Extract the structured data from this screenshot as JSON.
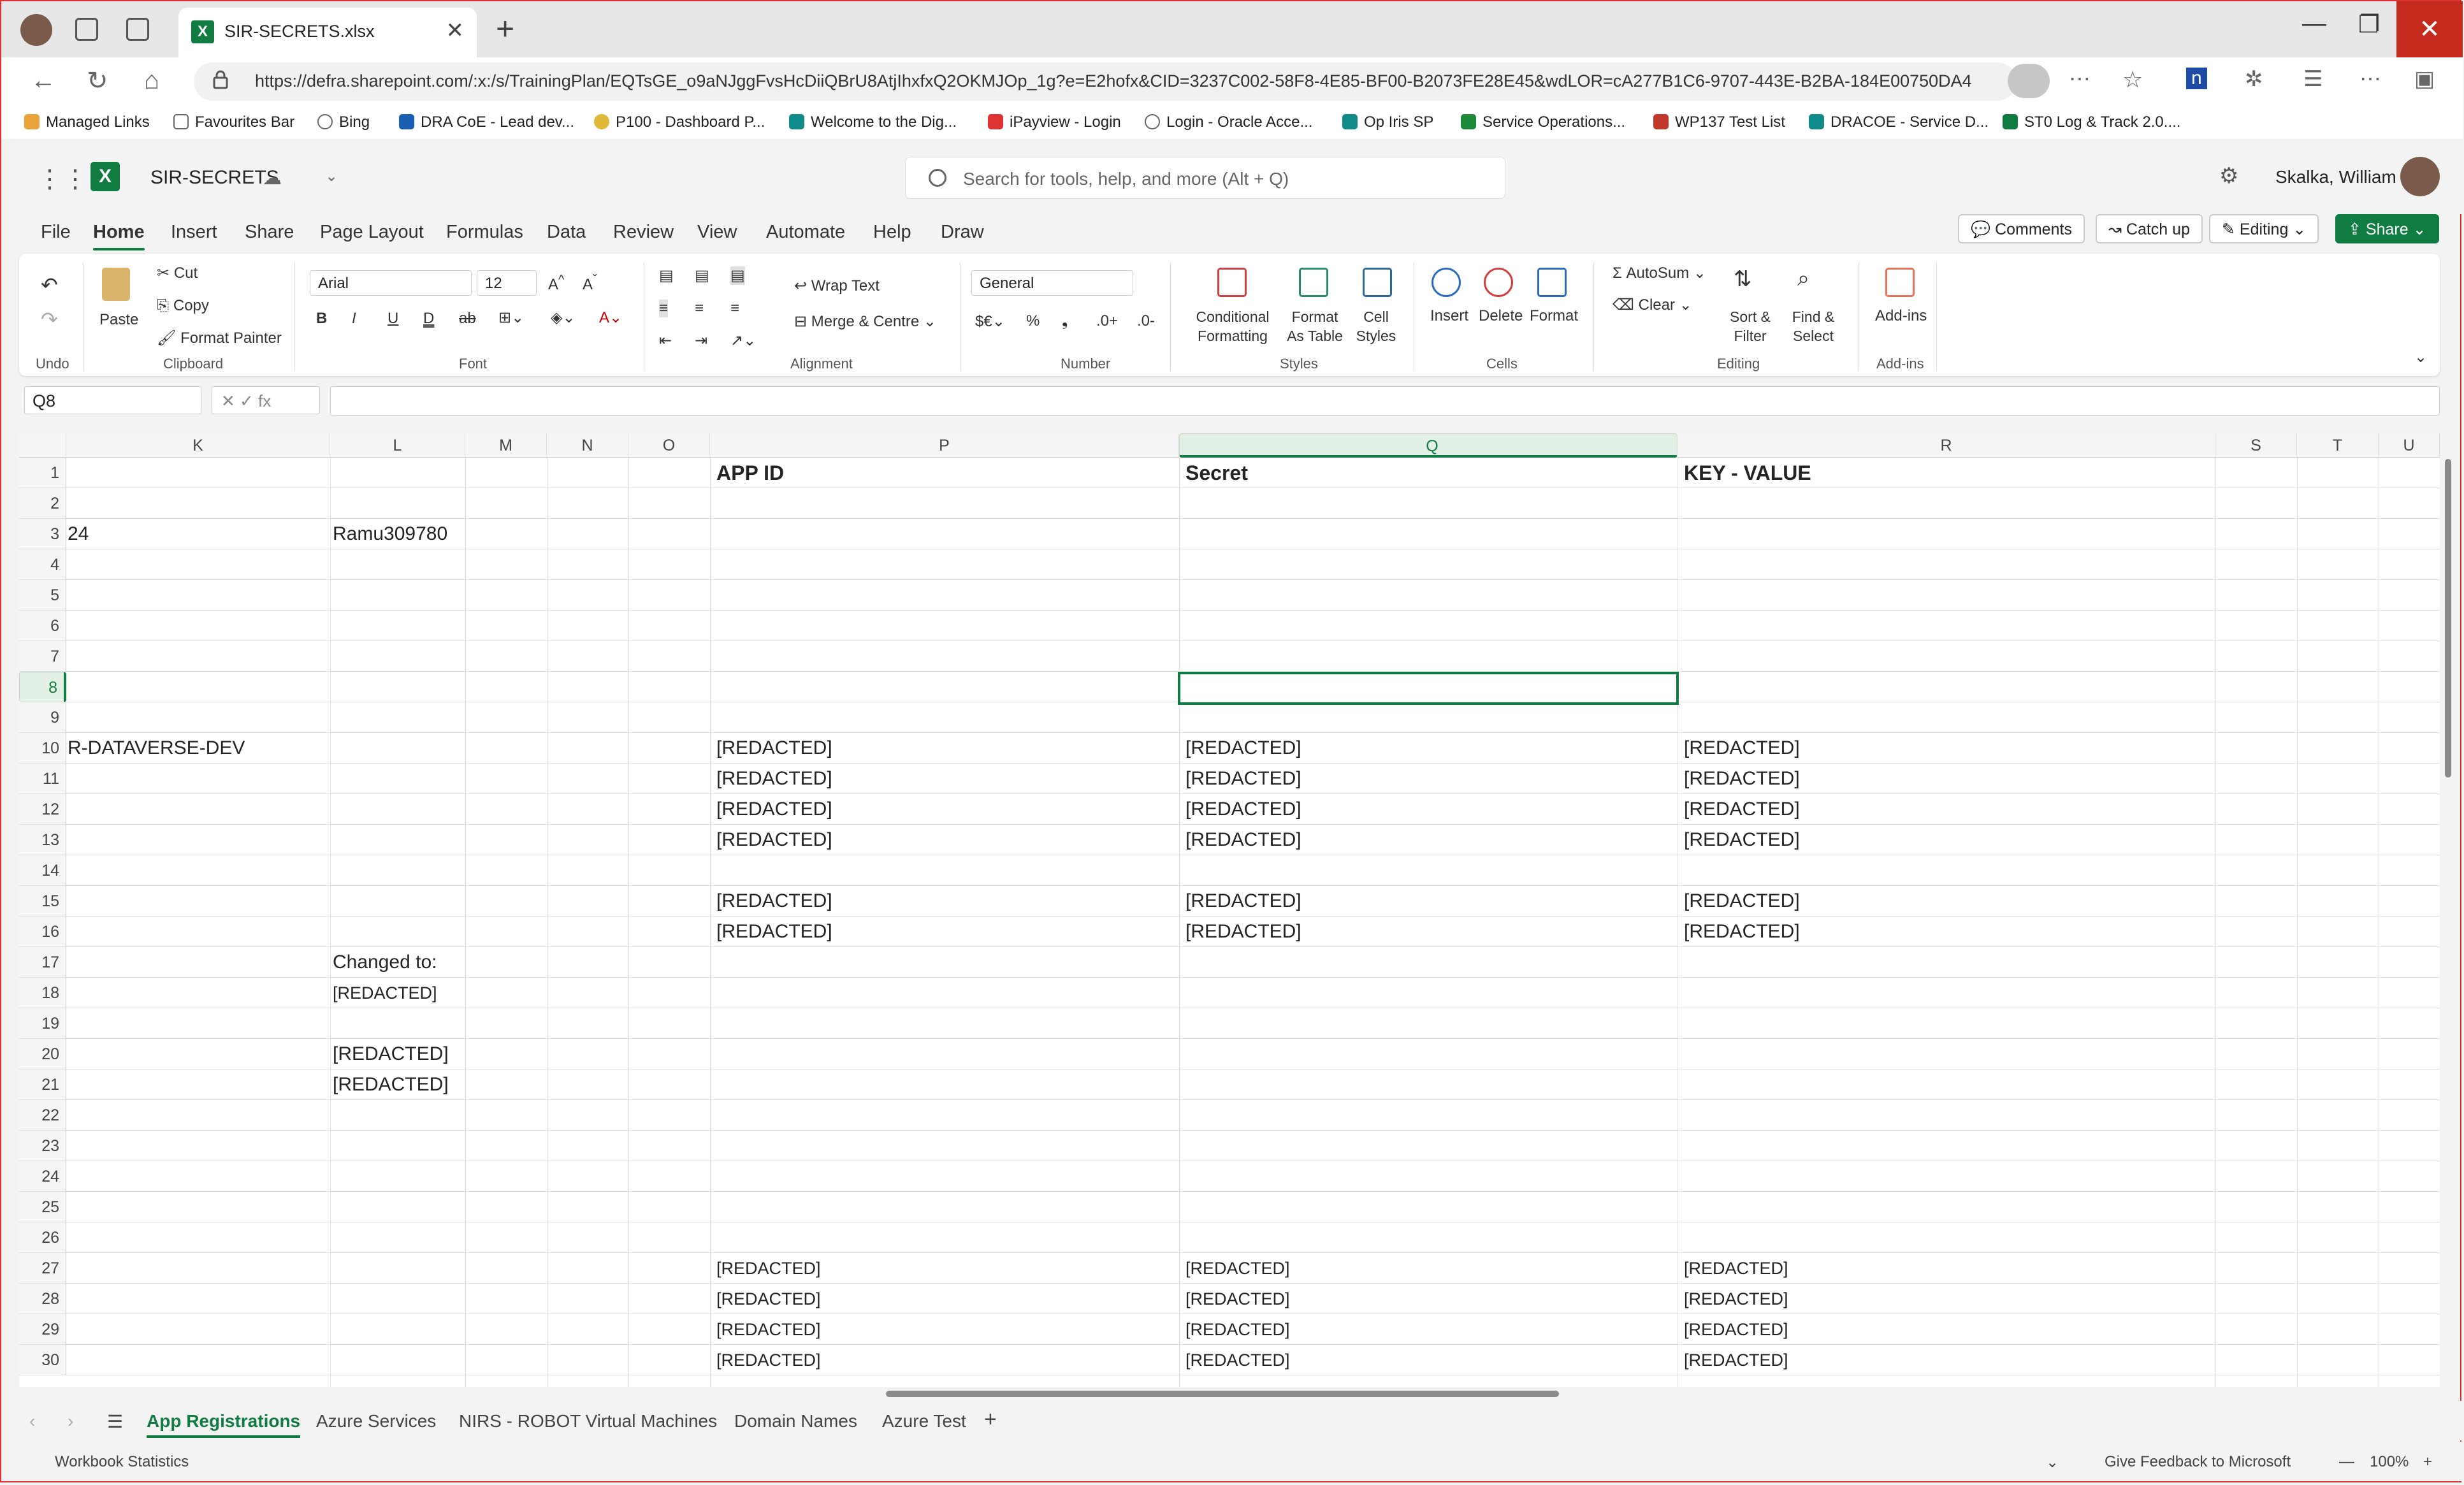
{
  "browser": {
    "tab_title": "SIR-SECRETS.xlsx",
    "url": "https://defra.sharepoint.com/:x:/s/TrainingPlan/EQTsGE_o9aNJggFvsHcDiiQBrU8AtjIhxfxQ2OKMJOp_1g?e=E2hofx&CID=3237C002-58F8-4E85-BF00-B2073FE28E45&wdLOR=cA277B1C6-9707-443E-B2BA-184E00750DA4",
    "favorites": [
      "Managed Links",
      "Favourites Bar",
      "Bing",
      "DRA CoE - Lead dev...",
      "P100 - Dashboard P...",
      "Welcome to the Dig...",
      "iPayview - Login",
      "Login - Oracle Acce...",
      "Op Iris SP",
      "Service Operations...",
      "WP137 Test List",
      "DRACOE - Service D...",
      "ST0 Log & Track 2.0...."
    ]
  },
  "app": {
    "doc_title": "SIR-SECRETS",
    "search_placeholder": "Search for tools, help, and more (Alt + Q)",
    "user_name": "Skalka, William",
    "menu": [
      "File",
      "Home",
      "Insert",
      "Share",
      "Page Layout",
      "Formulas",
      "Data",
      "Review",
      "View",
      "Automate",
      "Help",
      "Draw"
    ],
    "active_menu": "Home",
    "buttons": {
      "comments": "Comments",
      "catch_up": "Catch up",
      "editing": "Editing",
      "share": "Share"
    }
  },
  "ribbon": {
    "undo": "Undo",
    "paste": "Paste",
    "cut": "Cut",
    "copy": "Copy",
    "format_painter": "Format Painter",
    "clipboard": "Clipboard",
    "font_name": "Arial",
    "font_size": "12",
    "font": "Font",
    "wrap_text": "Wrap Text",
    "merge_centre": "Merge & Centre",
    "alignment": "Alignment",
    "number_format": "General",
    "number": "Number",
    "conditional_formatting": "Conditional Formatting",
    "format_as_table": "Format As Table",
    "cell_styles": "Cell Styles",
    "styles": "Styles",
    "insert": "Insert",
    "delete": "Delete",
    "format": "Format",
    "cells": "Cells",
    "autosum": "AutoSum",
    "clear": "Clear",
    "sort_filter": "Sort & Filter",
    "find_select": "Find & Select",
    "editing": "Editing",
    "add_ins": "Add-ins",
    "add_ins_group": "Add-ins"
  },
  "formula_bar": {
    "name_box": "Q8",
    "formula": ""
  },
  "sheet": {
    "columns": [
      "K",
      "L",
      "M",
      "N",
      "O",
      "P",
      "Q",
      "R",
      "S",
      "T",
      "U"
    ],
    "selected_column": "Q",
    "rows": [
      "1",
      "2",
      "3",
      "4",
      "5",
      "6",
      "7",
      "8",
      "9",
      "10",
      "11",
      "12",
      "13",
      "14",
      "15",
      "16",
      "17",
      "18",
      "19",
      "20",
      "21",
      "22",
      "23",
      "24",
      "25",
      "26",
      "27",
      "28",
      "29",
      "30"
    ],
    "selected_row": "8",
    "headers": {
      "app_id": "APP ID",
      "secret": "Secret",
      "key_value": "KEY - VALUE"
    },
    "k3": "24",
    "k10": "R-DATAVERSE-DEV",
    "l3": "Ramu309780",
    "l17": "Changed to:",
    "l18": "[REDACTED]",
    "l20": "[REDACTED]",
    "l21": "[REDACTED]",
    "data_rows": [
      {
        "row": 10,
        "app_id": "[REDACTED]",
        "secret": "[REDACTED]",
        "key": "[REDACTED]"
      },
      {
        "row": 11,
        "app_id": "[REDACTED]",
        "secret": "[REDACTED]",
        "key": "[REDACTED]"
      },
      {
        "row": 12,
        "app_id": "[REDACTED]",
        "secret": "[REDACTED]",
        "key": "[REDACTED]"
      },
      {
        "row": 13,
        "app_id": "[REDACTED]",
        "secret": "[REDACTED]",
        "key": "[REDACTED]"
      },
      {
        "row": 15,
        "app_id": "[REDACTED]",
        "secret": "[REDACTED]",
        "key": "[REDACTED]"
      },
      {
        "row": 16,
        "app_id": "[REDACTED]",
        "secret": "[REDACTED]",
        "key": "[REDACTED]"
      }
    ],
    "small_rows": [
      {
        "row": 27,
        "app_id": "[REDACTED]",
        "secret": "[REDACTED]",
        "key": "[REDACTED]"
      },
      {
        "row": 28,
        "app_id": "[REDACTED]",
        "secret": "[REDACTED]",
        "key": "[REDACTED]"
      },
      {
        "row": 29,
        "app_id": "[REDACTED]",
        "secret": "[REDACTED]",
        "key": "[REDACTED]"
      },
      {
        "row": 30,
        "app_id": "[REDACTED]",
        "secret": "[REDACTED]",
        "key": "[REDACTED]"
      }
    ]
  },
  "sheet_tabs": [
    "App Registrations",
    "Azure Services",
    "NIRS - ROBOT Virtual Machines",
    "Domain Names",
    "Azure Test"
  ],
  "active_sheet": "App Registrations",
  "status": {
    "left": "Workbook Statistics",
    "feedback": "Give Feedback to Microsoft",
    "zoom": "100%"
  },
  "colors": {
    "accent": "#107c41",
    "close": "#c42b1c"
  }
}
